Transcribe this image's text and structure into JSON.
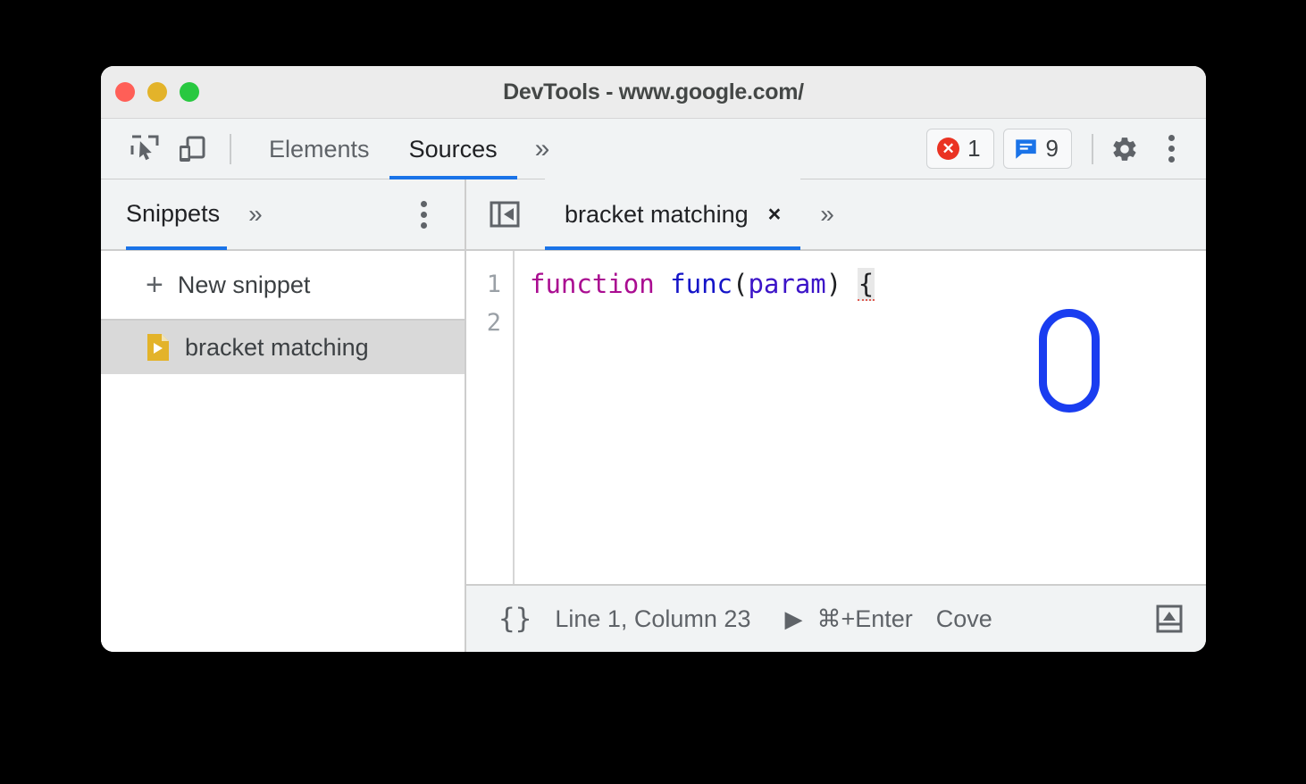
{
  "window": {
    "title": "DevTools - www.google.com/",
    "traffic_lights": [
      {
        "name": "close",
        "color": "#ff5f57"
      },
      {
        "name": "minimize",
        "color": "#e3b32a"
      },
      {
        "name": "maximize",
        "color": "#28c840"
      }
    ]
  },
  "toolbar": {
    "inspect_icon": "inspect-element-icon",
    "device_icon": "device-toolbar-icon",
    "tabs": [
      {
        "label": "Elements",
        "active": false
      },
      {
        "label": "Sources",
        "active": true
      }
    ],
    "more_tabs": "»",
    "errors": {
      "icon": "error-icon",
      "count": "1"
    },
    "messages": {
      "icon": "message-icon",
      "count": "9"
    },
    "settings_icon": "gear-icon",
    "menu_icon": "kebab-menu-icon"
  },
  "navigator": {
    "tab_label": "Snippets",
    "more_tabs": "»",
    "menu_icon": "kebab-menu-icon",
    "new_snippet": {
      "plus": "+",
      "label": "New snippet"
    },
    "items": [
      {
        "label": "bracket matching",
        "icon": "snippet-file-icon",
        "selected": true
      }
    ]
  },
  "editor": {
    "navigator_toggle_icon": "show-navigator-icon",
    "tab": {
      "label": "bracket matching",
      "close": "×"
    },
    "more_tabs": "»",
    "line_numbers": [
      "1",
      "2"
    ],
    "code": {
      "keyword": "function",
      "space": " ",
      "fn_name": "func",
      "open_paren": "(",
      "param": "param",
      "close_paren": ")",
      "gap": " ",
      "brace": "{"
    },
    "annotation": {
      "shape": "rounded-rect-highlight",
      "color": "#1a3df0"
    }
  },
  "statusbar": {
    "braces_icon": "{}",
    "position": "Line 1, Column 23",
    "play_icon": "▶",
    "shortcut": "⌘+Enter",
    "coverage": "Cove",
    "drawer_icon": "show-drawer-icon"
  },
  "colors": {
    "accent": "#1a73e8",
    "error": "#ea3323",
    "message": "#1a73e8",
    "annotation": "#1a3df0",
    "keyword": "#aa0d91",
    "function": "#1414c8",
    "snippet_icon": "#e3b32a"
  }
}
